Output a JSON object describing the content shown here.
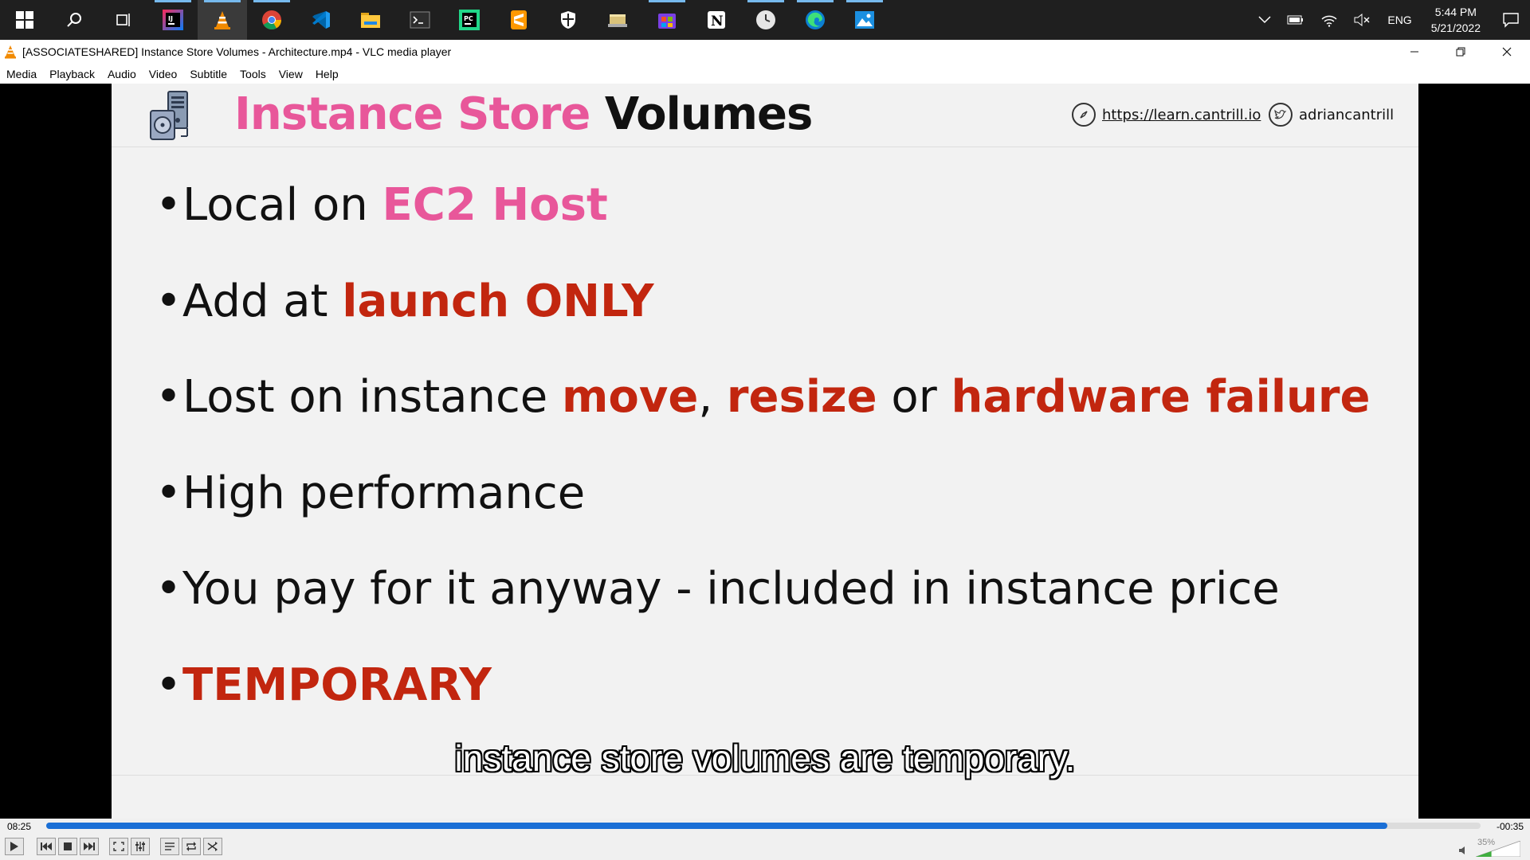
{
  "taskbar": {
    "apps": [
      "start-icon",
      "search-icon",
      "task-view-icon",
      "intellij-icon",
      "vlc-icon",
      "chrome-icon",
      "vscode-icon",
      "file-explorer-icon",
      "terminal-icon",
      "pycharm-icon",
      "sublime-icon",
      "security-icon",
      "app-icon",
      "store-icon",
      "notion-icon",
      "clock-app-icon",
      "edge-icon",
      "photos-icon"
    ],
    "tray": {
      "language": "ENG",
      "time": "5:44 PM",
      "date": "5/21/2022"
    }
  },
  "window": {
    "title": "[ASSOCIATESHARED] Instance Store Volumes - Architecture.mp4 - VLC media player"
  },
  "menu": {
    "items": [
      "Media",
      "Playback",
      "Audio",
      "Video",
      "Subtitle",
      "Tools",
      "View",
      "Help"
    ]
  },
  "slide": {
    "title_part1": "Instance Store",
    "title_part2": "Volumes",
    "site_link": "https://learn.cantrill.io",
    "twitter": "adriancantrill",
    "bullets": {
      "b1_a": "Local on ",
      "b1_b": "EC2 Host",
      "b2_a": "Add at ",
      "b2_b": "launch ONLY",
      "b3_a": "Lost on instance ",
      "b3_b": "move",
      "b3_c": ", ",
      "b3_d": "resize",
      "b3_e": " or ",
      "b3_f": "hardware failure",
      "b4": "High performance",
      "b5": "You pay for it anyway - included in instance price",
      "b6": "TEMPORARY"
    },
    "colors": {
      "pink": "#e8579a",
      "red": "#c2260f"
    }
  },
  "subtitle": "instance store volumes are temporary.",
  "player": {
    "elapsed": "08:25",
    "remaining": "-00:35",
    "progress_fraction": 0.935,
    "volume": "35%"
  }
}
